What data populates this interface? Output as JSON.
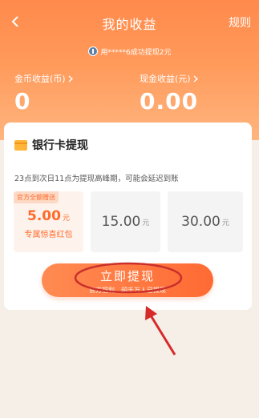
{
  "nav": {
    "title": "我的收益",
    "rules_label": "规则"
  },
  "notice": {
    "text": "用*****6成功提现2元"
  },
  "stats": {
    "coin": {
      "label": "金币收益(币)",
      "value": "0"
    },
    "cash": {
      "label": "现金收益(元)",
      "value": "0.00"
    }
  },
  "card": {
    "title": "银行卡提现",
    "hint": "23点到次日11点为提现高峰期，可能会延迟到账",
    "options": [
      {
        "tag": "官方全额赠送",
        "amount": "5.00",
        "unit": "元",
        "sub": "专属惊喜红包"
      },
      {
        "amount": "15.00",
        "unit": "元"
      },
      {
        "amount": "30.00",
        "unit": "元"
      }
    ]
  },
  "withdraw": {
    "label": "立即提现",
    "sub": "官方福利，超千万人已提现"
  },
  "colors": {
    "accent": "#ff6a2c",
    "hero": "#ff8a4c",
    "annotation": "#d62a2a"
  }
}
